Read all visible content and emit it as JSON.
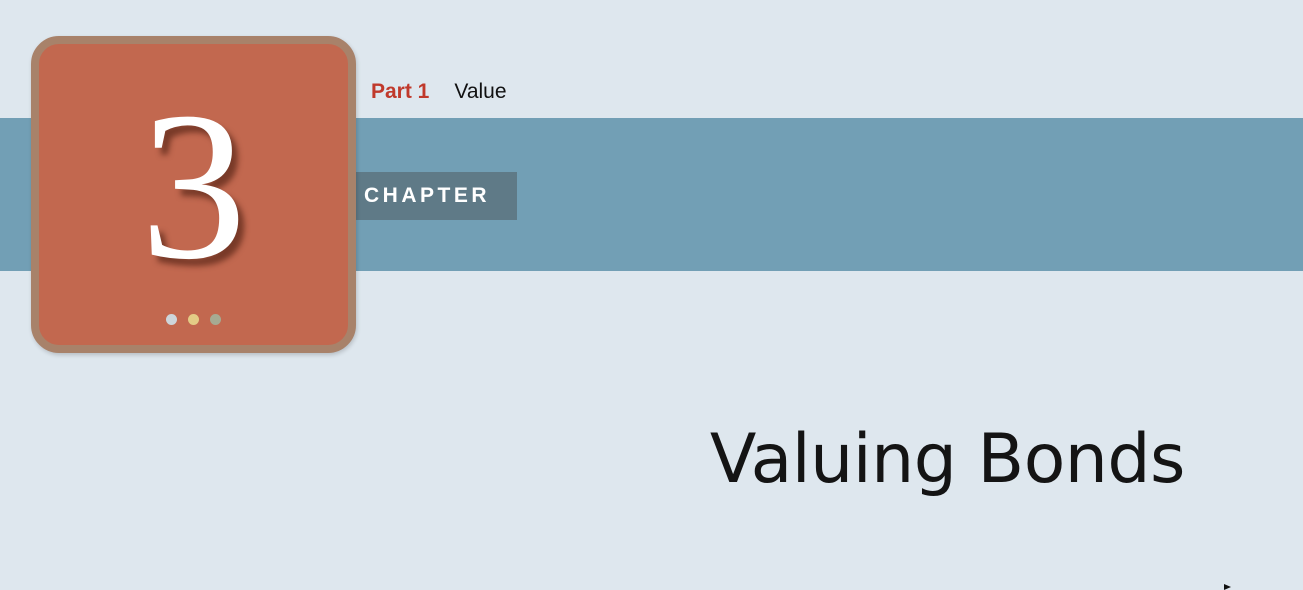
{
  "part": {
    "label": "Part 1",
    "name": "Value"
  },
  "chapter": {
    "tag": "CHAPTER",
    "number": "3",
    "title": "Valuing Bonds"
  },
  "badge": {
    "dots": [
      {
        "color": "#cdd5da"
      },
      {
        "color": "#e3cc86"
      },
      {
        "color": "#a6aa92"
      }
    ]
  },
  "colors": {
    "background": "#dee7ee",
    "band": "#729fb5",
    "chapter_tag": "#5f7a87",
    "badge_fill": "#c2684f",
    "badge_border": "#a8826a",
    "part_label": "#c0392b"
  },
  "icons": {
    "cursor": "mouse-pointer-icon"
  }
}
